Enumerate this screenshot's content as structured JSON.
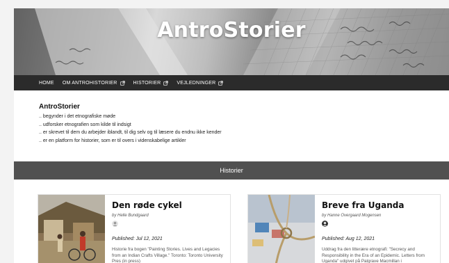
{
  "site": {
    "title": "AntroStorier"
  },
  "nav": {
    "items": [
      {
        "label": "HOME"
      },
      {
        "label": "OM ANTROHISTORIER"
      },
      {
        "label": "HISTORIER"
      },
      {
        "label": "VEJLEDNINGER"
      }
    ]
  },
  "intro": {
    "title": "AntroStorier",
    "lines": [
      ".. begynder i det etnografiske møde",
      ".. udforsker etnografien som kilde til indsigt",
      ".. er skrevet til dem du arbejder iblandt, til dig selv og til læsere du endnu ikke kender",
      ".. er en platform for historier, som er til overs i videnskabelige artikler"
    ]
  },
  "section": {
    "title": "Historier"
  },
  "cards": [
    {
      "title": "Den røde cykel",
      "author": "by Helle Bundgaard",
      "published": "Published: Jul 12, 2021",
      "excerpt": "Historie fra bogen \"Painting Stories. Lives and Legacies from an Indian Crafts Village.\" Toronto: Toronto University Pres (in press)",
      "thumb_icon": "village-photo",
      "avatar_icon": "user-avatar-icon"
    },
    {
      "title": "Breve fra Uganda",
      "author": "by Hanne Overgaard Mogensen",
      "published": "Published: Aug 12, 2021",
      "excerpt": "Uddrag fra den litterære etnografi: \"Secrecy and Responsibility in the Era of an Epidemic. Letters from Uganda\" udgivet på Palgrave Macmillan i",
      "thumb_icon": "rope-photo",
      "avatar_icon": "user-avatar-icon"
    }
  ],
  "colors": {
    "nav_bg": "#2b2b2b",
    "band_bg": "#505050",
    "page_bg": "#ffffff"
  }
}
